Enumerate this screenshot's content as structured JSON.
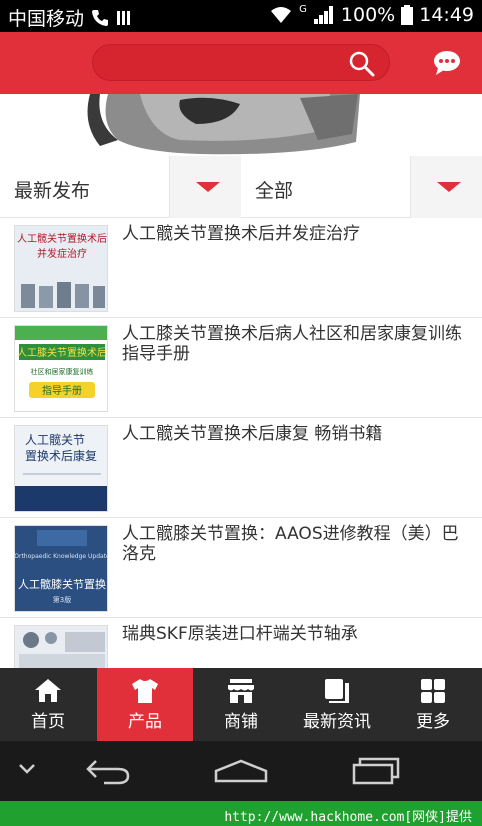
{
  "status_bar": {
    "carrier": "中国移动",
    "network_type": "G",
    "battery": "100%",
    "time": "14:49"
  },
  "filters": {
    "sort_label": "最新发布",
    "category_label": "全部"
  },
  "products": [
    {
      "title": "人工髋关节置换术后并发症治疗",
      "cover_text": "人工髋关节置换术后\n并发症治疗"
    },
    {
      "title": "人工膝关节置换术后病人社区和居家康复训练指导手册",
      "cover_text": "人工膝关节置换术后\n社区和居家康复训练\n指导手册"
    },
    {
      "title": "人工髋关节置换术后康复 畅销书籍",
      "cover_text": "人工髋关节\n置换术后康复"
    },
    {
      "title": "人工髋膝关节置换：AAOS进修教程（美）巴洛克",
      "cover_text": "人工髋膝关节置换"
    },
    {
      "title": "瑞典SKF原装进口杆端关节轴承",
      "cover_text": ""
    }
  ],
  "tabs": [
    {
      "label": "首页",
      "icon": "home-icon"
    },
    {
      "label": "产品",
      "icon": "shirt-icon"
    },
    {
      "label": "商铺",
      "icon": "store-icon"
    },
    {
      "label": "最新资讯",
      "icon": "news-icon"
    },
    {
      "label": "更多",
      "icon": "grid-icon"
    }
  ],
  "footer": {
    "text": "http://www.hackhome.com[网侠]提供"
  },
  "colors": {
    "accent": "#e2303a",
    "tab_bar": "#2b2b2b",
    "footer": "#1fa02f"
  }
}
